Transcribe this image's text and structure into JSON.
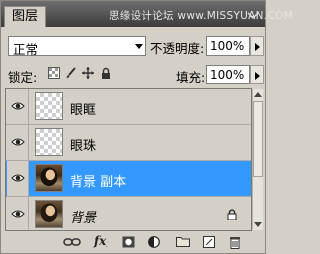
{
  "panel": {
    "tab_label": "图层",
    "watermark": "思缘设计论坛  www.MISSYUAN.COM"
  },
  "blend_mode": {
    "value": "正常"
  },
  "opacity": {
    "label": "不透明度:",
    "value": "100%"
  },
  "lock": {
    "label": "锁定:",
    "icons": [
      "lock-transparent-icon",
      "lock-paint-icon",
      "lock-move-icon",
      "lock-all-icon"
    ]
  },
  "fill": {
    "label": "填充:",
    "value": "100%"
  },
  "layers": [
    {
      "name": "眼眶",
      "thumbnail": "transparent-checker",
      "visible": true,
      "selected": false
    },
    {
      "name": "眼珠",
      "thumbnail": "transparent-checker",
      "visible": true,
      "selected": false
    },
    {
      "name": "背景 副本",
      "thumbnail": "portrait-photo",
      "visible": true,
      "selected": true
    },
    {
      "name": "背景",
      "thumbnail": "portrait-photo",
      "visible": true,
      "selected": false,
      "locked": true,
      "italic": true
    }
  ],
  "bottom_toolbar": {
    "icons": [
      "link-layers-icon",
      "fx-icon",
      "add-mask-icon",
      "adjustment-layer-icon",
      "new-group-icon",
      "new-layer-icon",
      "trash-icon"
    ]
  },
  "colors": {
    "selected_row": "#3399ff",
    "panel_bg": "#d4d0c8",
    "titlebar": "#4a4a4a"
  }
}
